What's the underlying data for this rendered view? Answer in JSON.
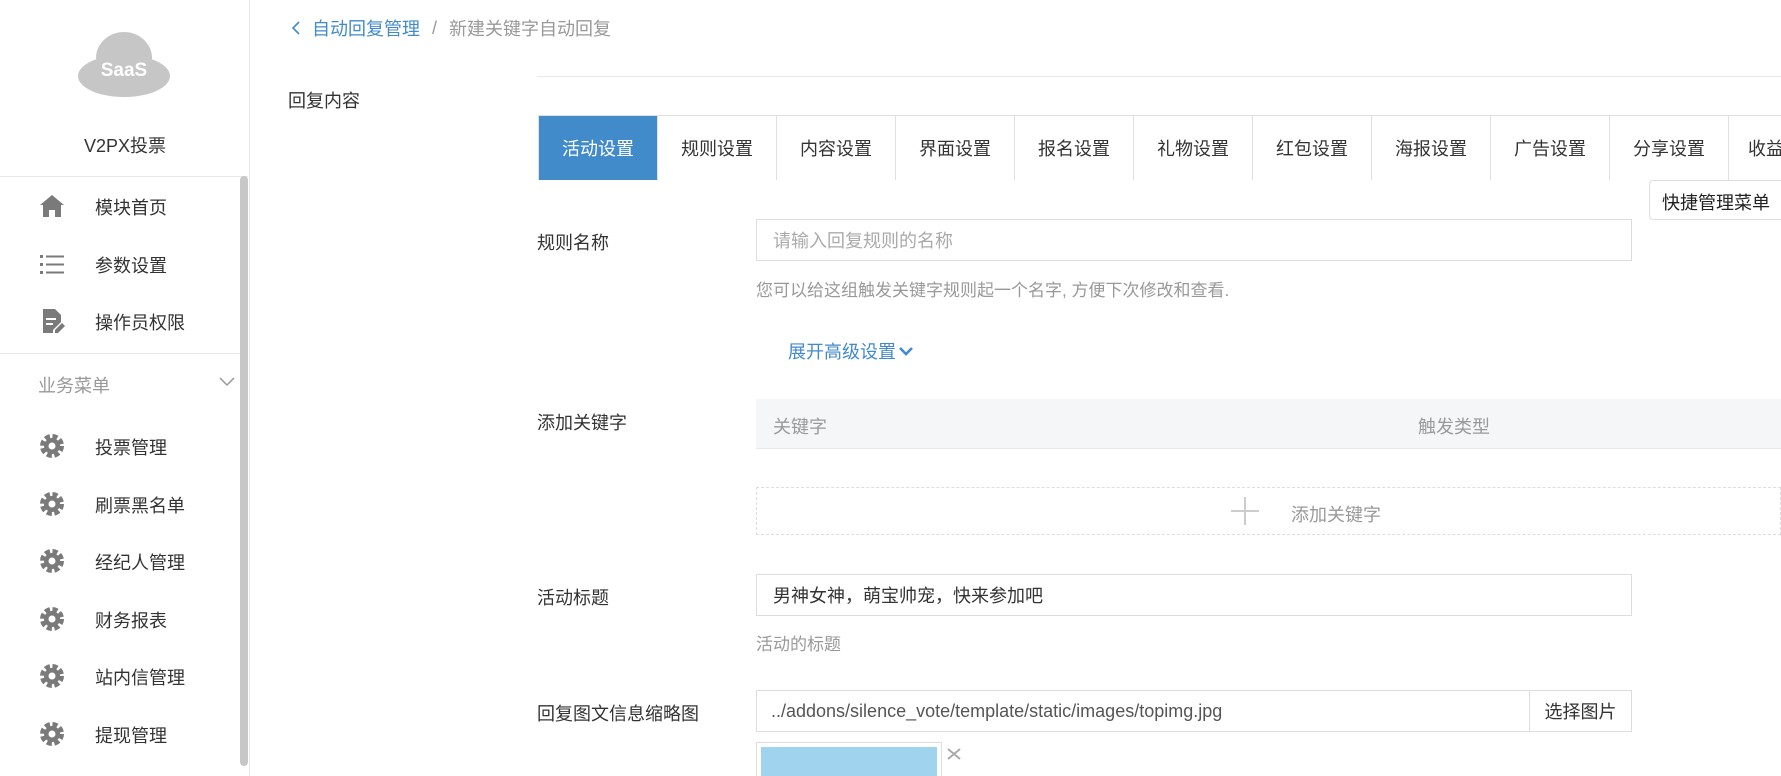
{
  "sidebar": {
    "logo_text": "SaaS",
    "app_name": "V2PX投票",
    "top_items": [
      {
        "label": "模块首页",
        "icon": "home-icon"
      },
      {
        "label": "参数设置",
        "icon": "list-icon"
      },
      {
        "label": "操作员权限",
        "icon": "document-edit-icon"
      }
    ],
    "group_title": "业务菜单",
    "group_items": [
      {
        "label": "投票管理",
        "icon": "gear-icon"
      },
      {
        "label": "刷票黑名单",
        "icon": "gear-icon"
      },
      {
        "label": "经纪人管理",
        "icon": "gear-icon"
      },
      {
        "label": "财务报表",
        "icon": "gear-icon"
      },
      {
        "label": "站内信管理",
        "icon": "gear-icon"
      },
      {
        "label": "提现管理",
        "icon": "gear-icon"
      }
    ]
  },
  "breadcrumb": {
    "parent": "自动回复管理",
    "separator": "/",
    "current": "新建关键字自动回复"
  },
  "section_label": "回复内容",
  "tabs": [
    {
      "label": "活动设置",
      "active": true
    },
    {
      "label": "规则设置",
      "active": false
    },
    {
      "label": "内容设置",
      "active": false
    },
    {
      "label": "界面设置",
      "active": false
    },
    {
      "label": "报名设置",
      "active": false
    },
    {
      "label": "礼物设置",
      "active": false
    },
    {
      "label": "红包设置",
      "active": false
    },
    {
      "label": "海报设置",
      "active": false
    },
    {
      "label": "广告设置",
      "active": false
    },
    {
      "label": "分享设置",
      "active": false
    },
    {
      "label": "收益",
      "active": false
    }
  ],
  "quick_menu_label": "快捷管理菜单",
  "form": {
    "rule_name": {
      "label": "规则名称",
      "placeholder": "请输入回复规则的名称",
      "help": "您可以给这组触发关键字规则起一个名字, 方便下次修改和查看."
    },
    "advanced_link": "展开高级设置",
    "keywords": {
      "label": "添加关键字",
      "col_keyword": "关键字",
      "col_trigger": "触发类型",
      "add_label": "添加关键字"
    },
    "activity_title": {
      "label": "活动标题",
      "value": "男神女神，萌宝帅宠，快来参加吧",
      "help": "活动的标题"
    },
    "thumbnail": {
      "label": "回复图文信息缩略图",
      "path": "../addons/silence_vote/template/static/images/topimg.jpg",
      "button": "选择图片"
    }
  },
  "colors": {
    "primary": "#428bca",
    "sidebar_icon": "#7a7a7a",
    "logo_cloud": "#c6c6c6"
  }
}
